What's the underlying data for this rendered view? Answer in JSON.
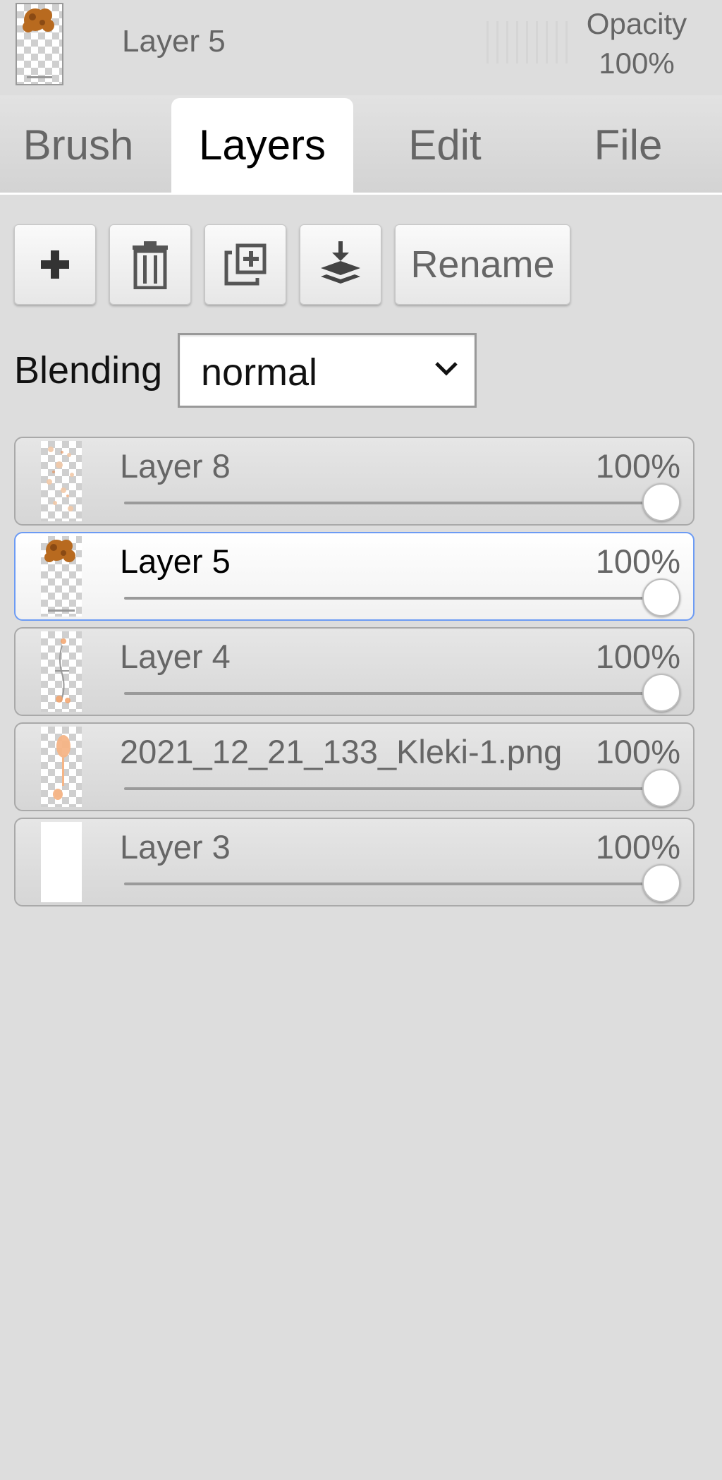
{
  "header": {
    "current_layer_name": "Layer 5",
    "opacity_label": "Opacity",
    "opacity_value": "100%"
  },
  "tabs": [
    {
      "label": "Brush",
      "active": false
    },
    {
      "label": "Layers",
      "active": true
    },
    {
      "label": "Edit",
      "active": false
    },
    {
      "label": "File",
      "active": false
    }
  ],
  "toolbar": {
    "add_icon": "plus-icon",
    "delete_icon": "trash-icon",
    "duplicate_icon": "duplicate-icon",
    "merge_icon": "merge-down-icon",
    "rename_label": "Rename"
  },
  "blending": {
    "label": "Blending",
    "value": "normal"
  },
  "layers": [
    {
      "name": "Layer 8",
      "opacity_label": "100%",
      "opacity": 1.0,
      "selected": false,
      "thumb": "sketch"
    },
    {
      "name": "Layer 5",
      "opacity_label": "100%",
      "opacity": 1.0,
      "selected": true,
      "thumb": "hair"
    },
    {
      "name": "Layer 4",
      "opacity_label": "100%",
      "opacity": 1.0,
      "selected": false,
      "thumb": "figure"
    },
    {
      "name": "2021_12_21_133_Kleki-1.png",
      "opacity_label": "100%",
      "opacity": 1.0,
      "selected": false,
      "thumb": "skin"
    },
    {
      "name": "Layer 3",
      "opacity_label": "100%",
      "opacity": 1.0,
      "selected": false,
      "thumb": "white"
    }
  ],
  "colors": {
    "accent_selected_border": "#6c9bf4",
    "panel_background": "#dddddd"
  }
}
